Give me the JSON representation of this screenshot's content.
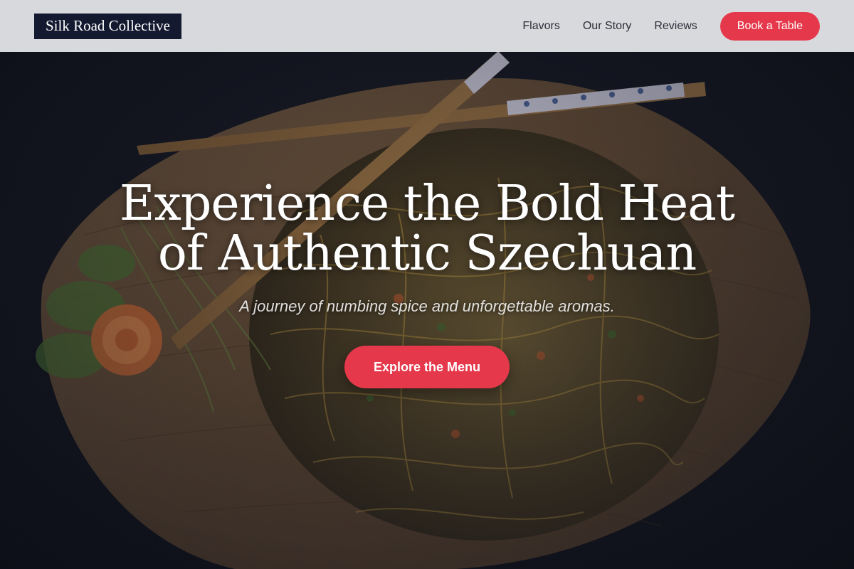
{
  "brand": {
    "name": "Silk Road Collective"
  },
  "nav": {
    "links": [
      "Flavors",
      "Our Story",
      "Reviews"
    ],
    "cta_label": "Book a Table"
  },
  "hero": {
    "title_line1": "Experience the Bold Heat",
    "title_line2": "of Authentic Szechuan",
    "subtitle": "A journey of numbing spice and unforgettable aromas.",
    "cta_label": "Explore the Menu"
  },
  "colors": {
    "accent": "#e5384b",
    "logo_bg": "#131a30",
    "navbar_bg": "#e1e2e5",
    "text_dark": "#2a2d36"
  }
}
